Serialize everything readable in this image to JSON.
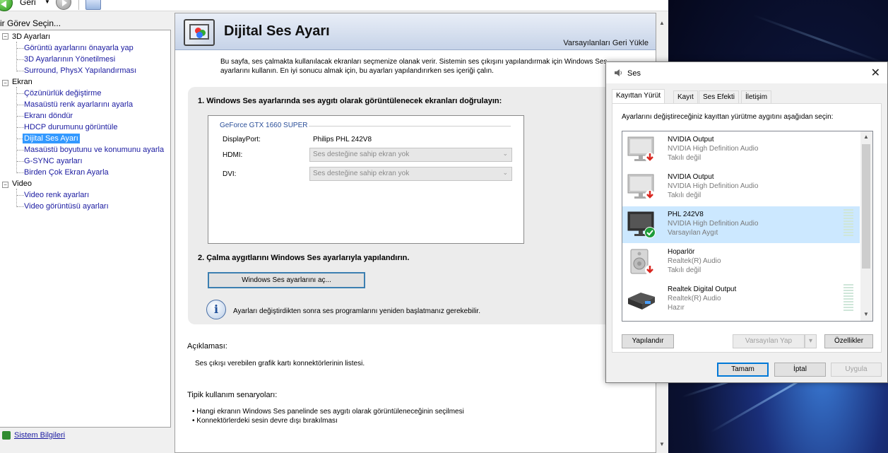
{
  "toolbar": {
    "back_label": "Geri"
  },
  "task_label": "ir Görev Seçin...",
  "tree": {
    "groups": [
      {
        "label": "3D Ayarları",
        "items": [
          "Görüntü ayarlarını önayarla yap",
          "3D Ayarlarının Yönetilmesi",
          "Surround, PhysX Yapılandırması"
        ]
      },
      {
        "label": "Ekran",
        "items": [
          "Çözünürlük değiştirme",
          "Masaüstü renk ayarlarını ayarla",
          "Ekranı döndür",
          "HDCP durumunu görüntüle",
          "Dijital Ses Ayarı",
          "Masaüstü boyutunu ve konumunu ayarla",
          "G-SYNC ayarları",
          "Birden Çok Ekran Ayarla"
        ]
      },
      {
        "label": "Video",
        "items": [
          "Video renk ayarları",
          "Video görüntüsü ayarları"
        ]
      }
    ],
    "selected": "Dijital Ses Ayarı"
  },
  "system_info": "Sistem Bilgileri",
  "content": {
    "title": "Dijital Ses Ayarı",
    "restore": "Varsayılanları Geri Yükle",
    "intro": "Bu sayfa, ses çalmakta kullanılacak ekranları seçmenize olanak verir. Sistemin ses çıkışını yapılandırmak için Windows Ses ayarlarını kullanın. En iyi sonucu almak için, bu ayarları yapılandırırken ses içeriği çalın.",
    "step1": "1. Windows Ses ayarlarında ses aygıtı olarak görüntülenecek ekranları doğrulayın:",
    "gpu": "GeForce GTX 1660 SUPER",
    "rows": [
      {
        "label": "DisplayPort:",
        "value": "Philips PHL 242V8"
      },
      {
        "label": "HDMI:",
        "value": "Ses desteğine sahip ekran yok"
      },
      {
        "label": "DVI:",
        "value": "Ses desteğine sahip ekran yok"
      }
    ],
    "step2": "2. Çalma aygıtlarını Windows Ses ayarlarıyla yapılandırın.",
    "open_button": "Windows Ses ayarlarını aç...",
    "info": "Ayarları değiştirdikten sonra ses programlarını yeniden başlatmanız gerekebilir.",
    "desc_label": "Açıklaması:",
    "desc_text": "Ses çıkışı verebilen grafik kartı konnektörlerinin listesi.",
    "usage_label": "Tipik kullanım senaryoları:",
    "usage": [
      "Hangi ekranın Windows Ses panelinde ses aygıtı olarak görüntüleneceğinin seçilmesi",
      "Konnektörlerdeki sesin devre dışı bırakılması"
    ]
  },
  "sound": {
    "title": "Ses",
    "tabs": [
      "Kayıttan Yürüt",
      "Kayıt",
      "Ses Efekti",
      "İletişim"
    ],
    "active_tab": "Kayıttan Yürüt",
    "instruction": "Ayarlarını değiştireceğiniz kayıttan yürütme aygıtını aşağıdan seçin:",
    "devices": [
      {
        "name": "NVIDIA Output",
        "sub": "NVIDIA High Definition Audio",
        "status": "Takılı değil",
        "icon": "monitor-icon",
        "badge": "down-arrow-icon",
        "selected": false
      },
      {
        "name": "NVIDIA Output",
        "sub": "NVIDIA High Definition Audio",
        "status": "Takılı değil",
        "icon": "monitor-icon",
        "badge": "down-arrow-icon",
        "selected": false
      },
      {
        "name": "PHL 242V8",
        "sub": "NVIDIA High Definition Audio",
        "status": "Varsayılan Aygıt",
        "icon": "monitor-icon",
        "badge": "checkmark-icon",
        "selected": true
      },
      {
        "name": "Hoparlör",
        "sub": "Realtek(R) Audio",
        "status": "Takılı değil",
        "icon": "speaker-icon",
        "badge": "down-arrow-icon",
        "selected": false
      },
      {
        "name": "Realtek Digital Output",
        "sub": "Realtek(R) Audio",
        "status": "Hazır",
        "icon": "digital-output-icon",
        "badge": "",
        "selected": false
      }
    ],
    "configure": "Yapılandır",
    "set_default": "Varsayılan Yap",
    "properties": "Özellikler",
    "ok": "Tamam",
    "cancel": "İptal",
    "apply": "Uygula"
  }
}
